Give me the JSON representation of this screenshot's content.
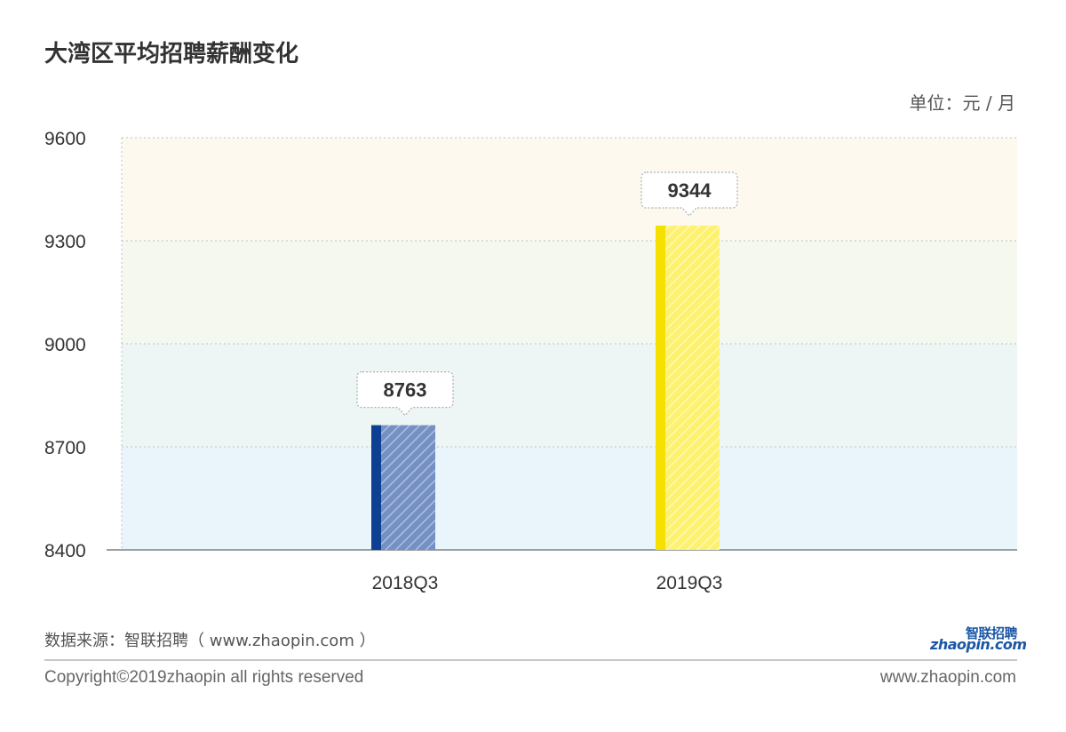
{
  "header": {
    "title": "大湾区平均招聘薪酬变化",
    "unit": "单位：元 / 月"
  },
  "chart_data": {
    "type": "bar",
    "categories": [
      "2018Q3",
      "2019Q3"
    ],
    "values": [
      8763,
      9344
    ],
    "ylim": [
      8400,
      9600
    ],
    "yticks": [
      8400,
      8700,
      9000,
      9300,
      9600
    ],
    "value_labels": [
      "8763",
      "9344"
    ],
    "bar_colors": [
      "#6f8cc0",
      "#fdf06a"
    ],
    "bar_edge_colors": [
      "#0d3f92",
      "#f5e000"
    ],
    "band_colors": [
      "#eaf5fb",
      "#edf6f4",
      "#f5f8ef",
      "#fdf9ee"
    ],
    "grid": "dotted horizontal"
  },
  "footer": {
    "source": "数据来源：智联招聘（ www.zhaopin.com ）",
    "copyright": "Copyright©2019zhaopin all rights reserved",
    "website": "www.zhaopin.com",
    "logo_cn": "智联招聘",
    "logo_en": "zhaopin.com"
  },
  "colors": {
    "axis": "#9aa0a6",
    "grid": "#c8ccd0",
    "text": "#333333"
  }
}
